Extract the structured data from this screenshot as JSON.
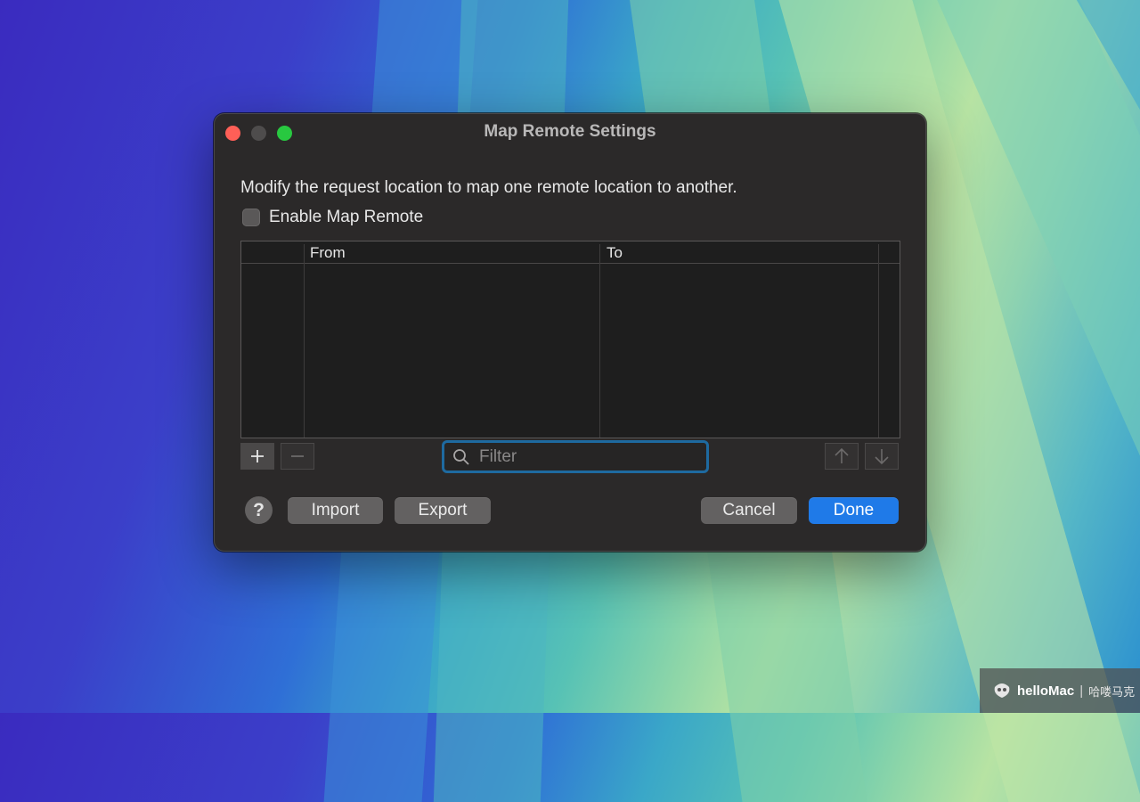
{
  "window": {
    "title": "Map Remote Settings",
    "description": "Modify the request location to map one remote location to another.",
    "enable_label": "Enable Map Remote",
    "enable_checked": false
  },
  "table": {
    "columns": [
      "From",
      "To"
    ],
    "rows": []
  },
  "toolbar": {
    "add_symbol": "+",
    "remove_symbol": "−",
    "filter_placeholder": "Filter",
    "up_symbol": "↑",
    "down_symbol": "↓"
  },
  "buttons": {
    "help": "?",
    "import": "Import",
    "export": "Export",
    "cancel": "Cancel",
    "done": "Done"
  },
  "colors": {
    "accent": "#1f7ae8",
    "filter_focus": "#1e6aa0",
    "window_bg": "#2b2929"
  },
  "watermark": {
    "brand": "helloMac",
    "cn": "哈喽马克"
  }
}
